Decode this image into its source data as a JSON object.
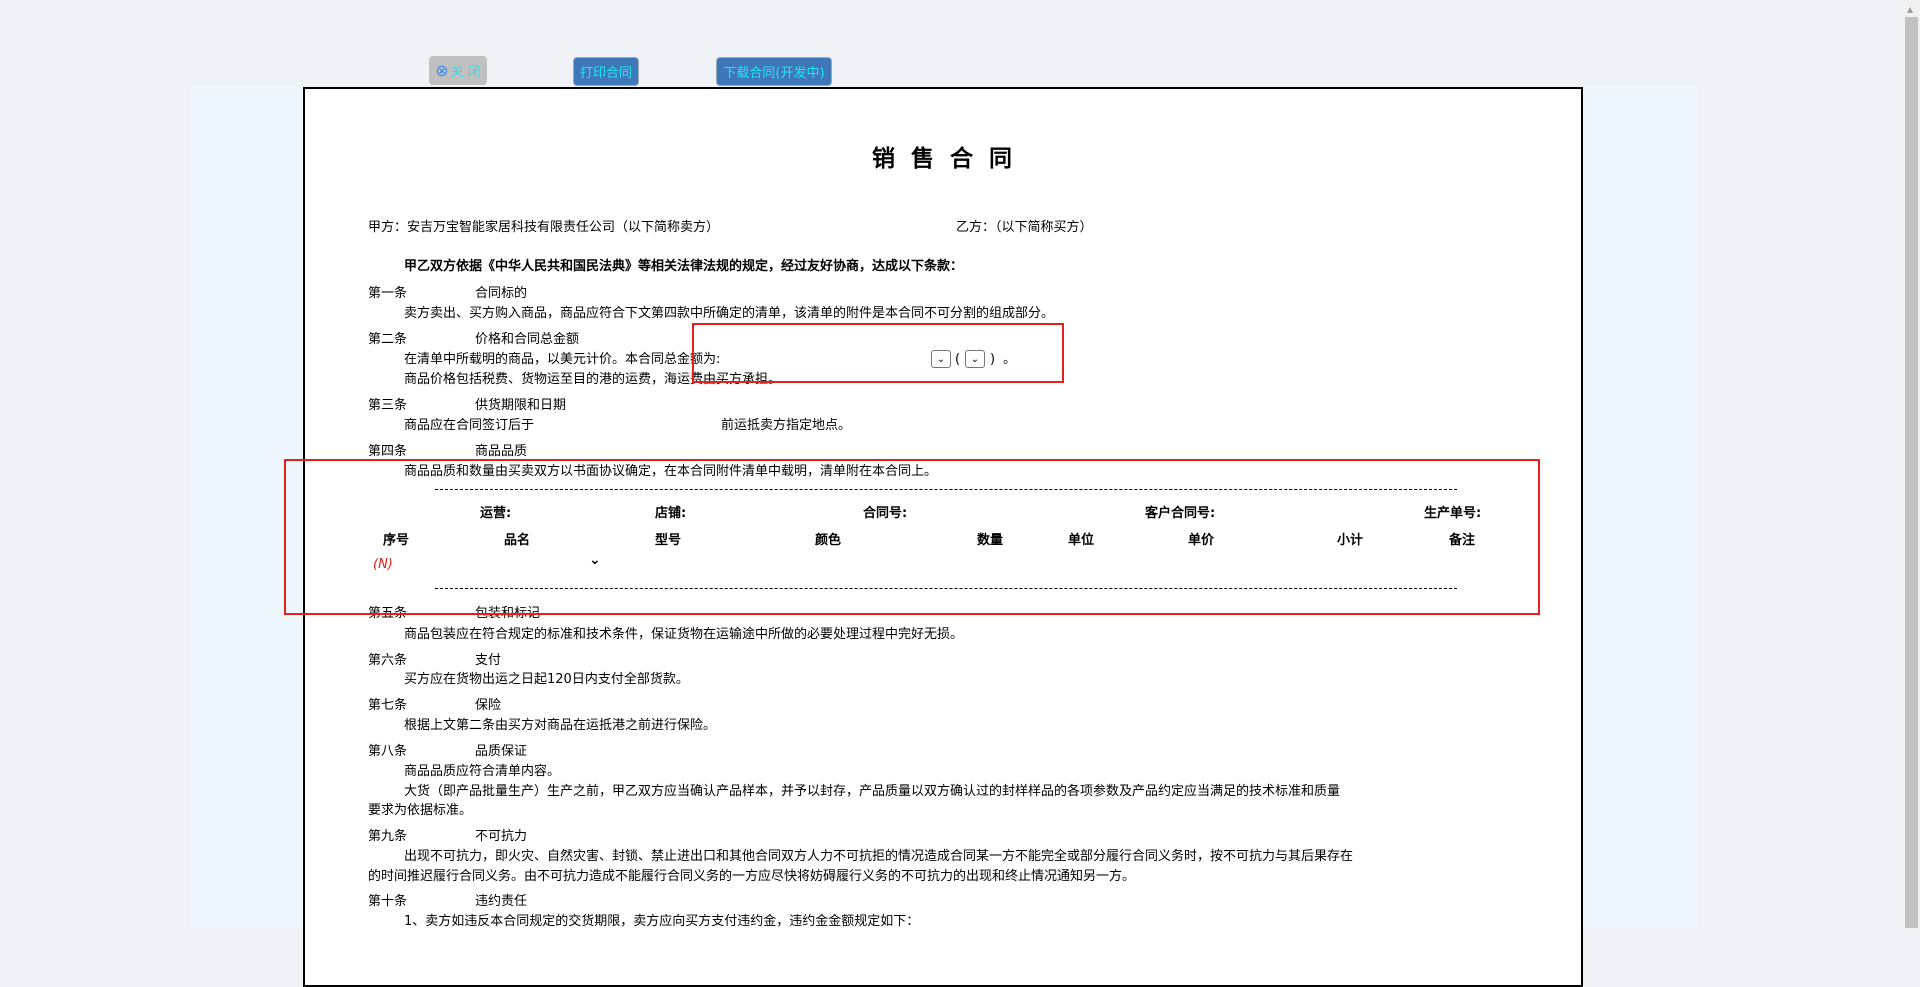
{
  "toolbar": {
    "close_label": "关 闭",
    "print_label": "打印合同",
    "download_label": "下载合同(开发中)"
  },
  "title": "销 售 合 同",
  "party_a": "甲方：安吉万宝智能家居科技有限责任公司（以下简称卖方）",
  "party_b": "乙方：（以下简称买方）",
  "intro": "甲乙双方依据《中华人民共和国民法典》等相关法律法规的规定，经过友好协商，达成以下条款：",
  "clauses": [
    {
      "no": "第一条",
      "title": "合同标的",
      "lines": [
        "卖方卖出、买方购入商品，商品应符合下文第四款中所确定的清单，该清单的附件是本合同不可分割的组成部分。"
      ]
    },
    {
      "no": "第二条",
      "title": "价格和合同总金额",
      "lines": [
        "在清单中所载明的商品，以美元计价。本合同总金额为:",
        "商品价格包括税费、货物运至目的港的运费，海运费由买方承担。"
      ]
    },
    {
      "no": "第三条",
      "title": "供货期限和日期",
      "lines": [
        "商品应在合同签订后于",
        "前运抵卖方指定地点。"
      ]
    },
    {
      "no": "第四条",
      "title": "商品品质",
      "lines": [
        "商品品质和数量由买卖双方以书面协议确定，在本合同附件清单中载明，清单附在本合同上。"
      ]
    },
    {
      "no": "第五条",
      "title": "包装和标记",
      "lines": [
        "商品包装应在符合规定的标准和技术条件，保证货物在运输途中所做的必要处理过程中完好无损。"
      ]
    },
    {
      "no": "第六条",
      "title": "支付",
      "lines": [
        "买方应在货物出运之日起120日内支付全部货款。"
      ]
    },
    {
      "no": "第七条",
      "title": "保险",
      "lines": [
        "根据上文第二条由买方对商品在运抵港之前进行保险。"
      ]
    },
    {
      "no": "第八条",
      "title": "品质保证",
      "lines": [
        "商品品质应符合清单内容。",
        "大货（即产品批量生产）生产之前，甲乙双方应当确认产品样本，并予以封存，产品质量以双方确认过的封样样品的各项参数及产品约定应当满足的技术标准和质量",
        "要求为依据标准。"
      ]
    },
    {
      "no": "第九条",
      "title": "不可抗力",
      "lines": [
        "出现不可抗力，即火灾、自然灾害、封锁、禁止进出口和其他合同双方人力不可抗拒的情况造成合同某一方不能完全或部分履行合同义务时，按不可抗力与其后果存在",
        "的时间推迟履行合同义务。由不可抗力造成不能履行合同义务的一方应尽快将妨碍履行义务的不可抗力的出现和终止情况通知另一方。"
      ]
    },
    {
      "no": "第十条",
      "title": "违约责任",
      "lines": [
        "1、卖方如违反本合同规定的交货期限，卖方应向买方支付违约金，违约金金额规定如下："
      ]
    }
  ],
  "amount_suffix": {
    "open": "(",
    "close": ")",
    "end": "。"
  },
  "list_header": {
    "operation": "运营:",
    "shop": "店铺:",
    "contract_no": "合同号:",
    "customer_contract_no": "客户合同号:",
    "production_no": "生产单号:"
  },
  "columns": [
    "序号",
    "品名",
    "型号",
    "颜色",
    "数量",
    "单位",
    "单价",
    "小计",
    "备注"
  ],
  "row_marker": "(N)",
  "colors": {
    "highlight": "#e8201c",
    "button": "#3e78b9",
    "link_text": "#22e6ef"
  }
}
